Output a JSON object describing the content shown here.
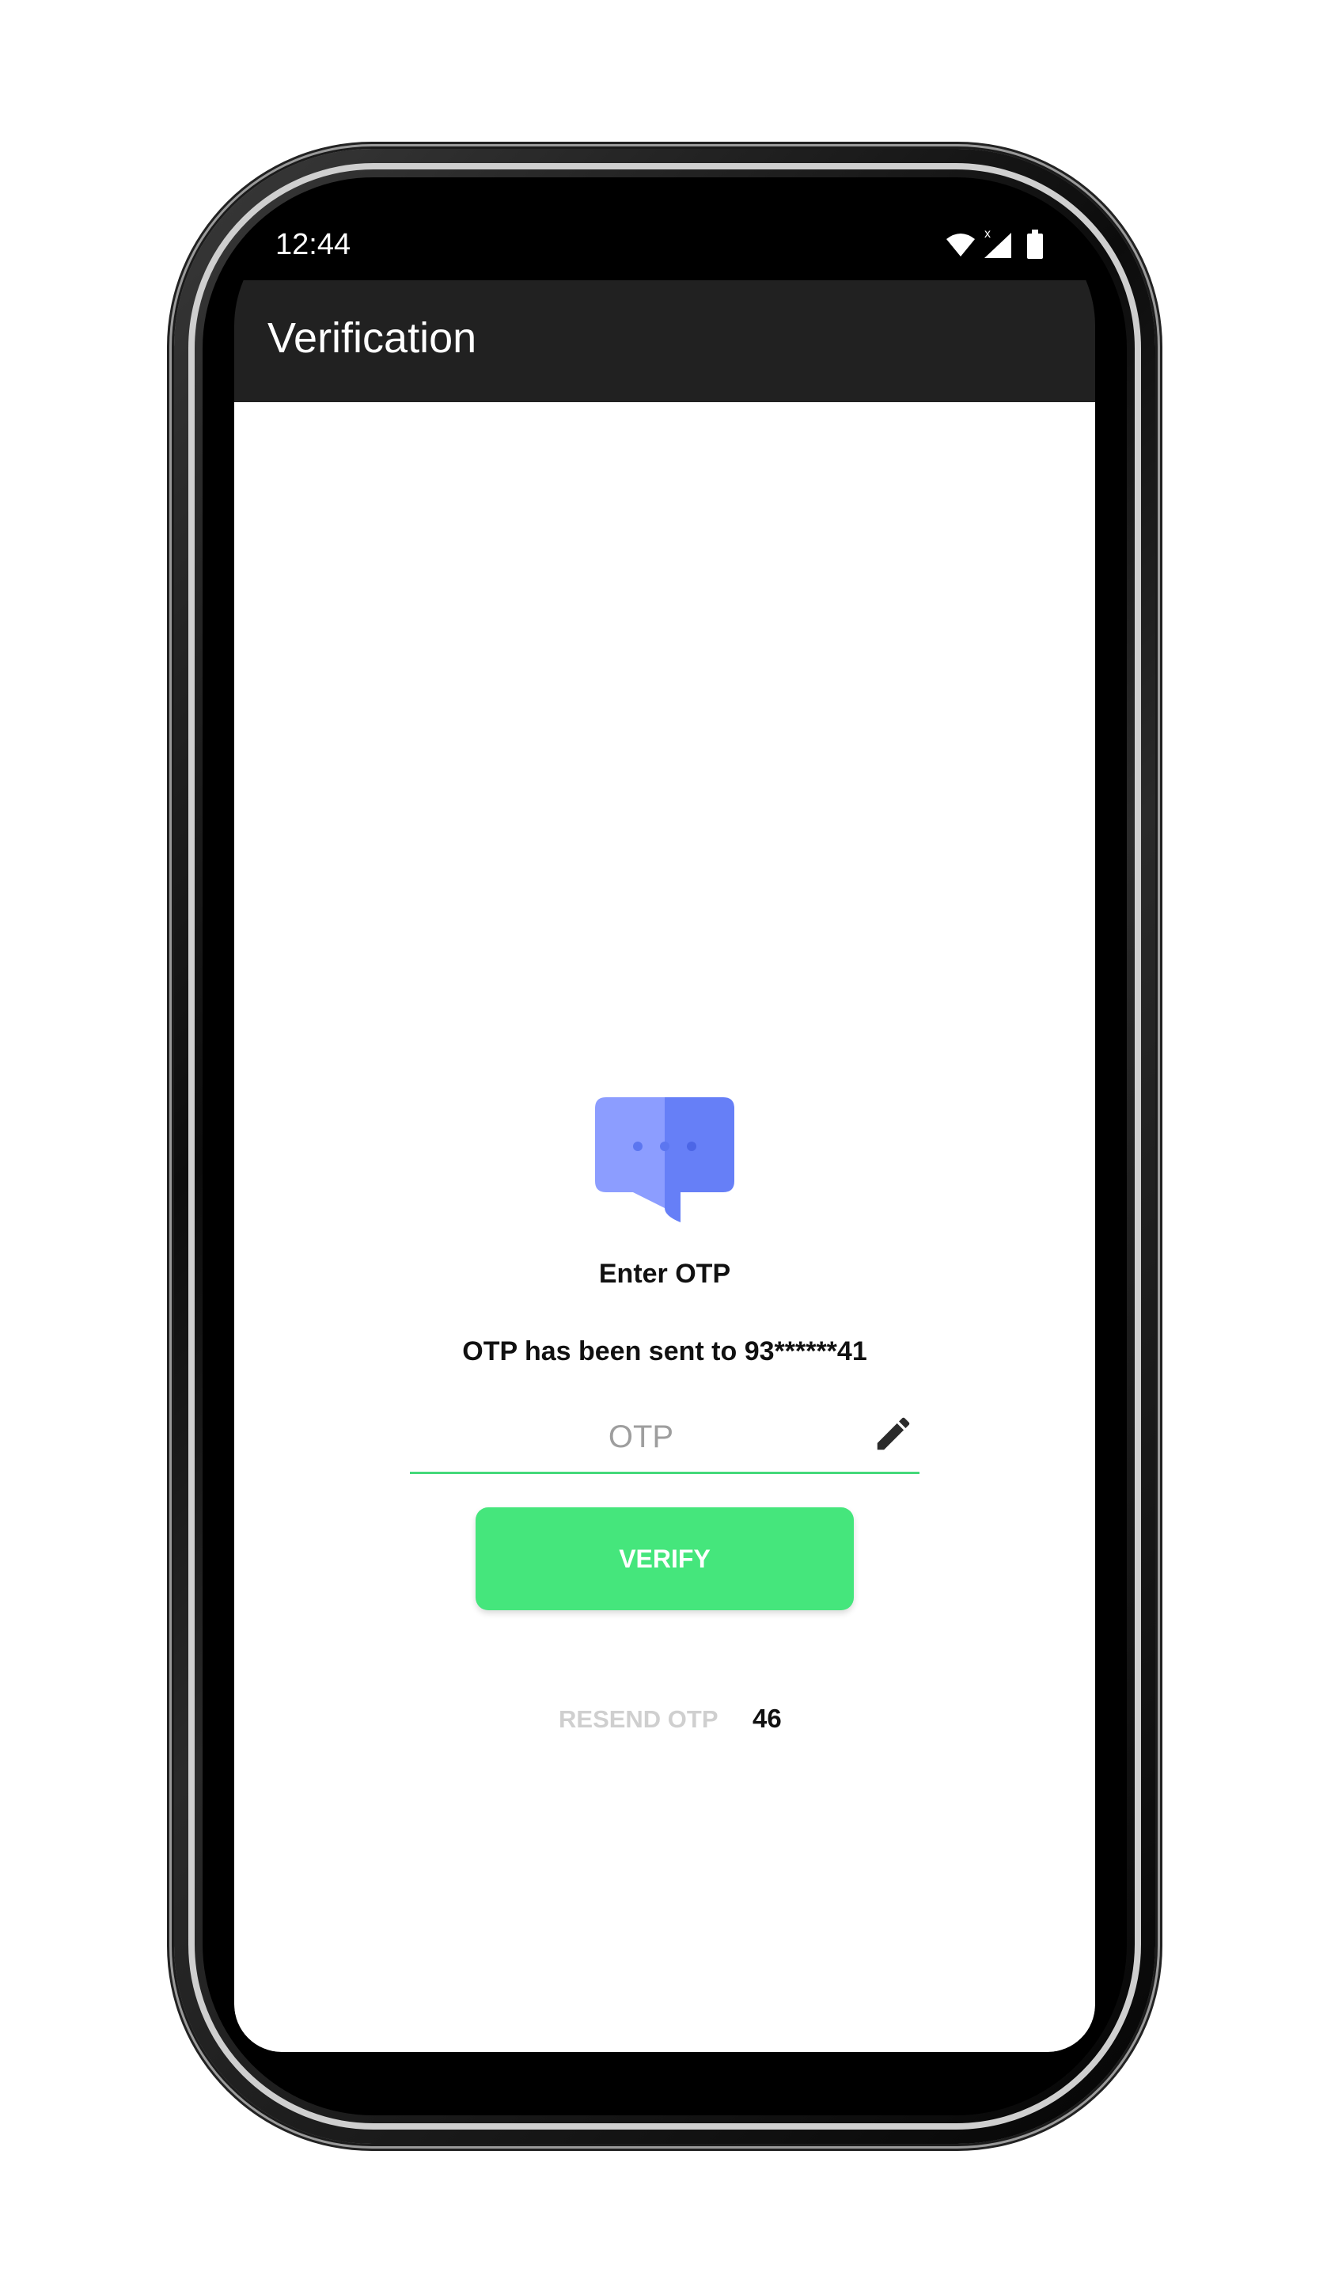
{
  "status_bar": {
    "time": "12:44",
    "icons": [
      "wifi-icon",
      "cellular-no-service-icon",
      "battery-icon"
    ]
  },
  "app_bar": {
    "title": "Verification"
  },
  "verification": {
    "icon": "chat-bubble-icon",
    "heading": "Enter OTP",
    "message": "OTP has been sent to 93******41",
    "otp_input": {
      "placeholder": "OTP",
      "value": ""
    },
    "edit_icon": "pencil-icon",
    "verify_label": "VERIFY",
    "resend_label": "RESEND OTP",
    "countdown": "46"
  },
  "colors": {
    "app_bar": "#212121",
    "accent_green": "#45e67c",
    "underline_green": "#45d97a",
    "chat_icon_light": "#8c9dff",
    "chat_icon_dark": "#667ff7",
    "resend_disabled": "#cfcfcf"
  }
}
